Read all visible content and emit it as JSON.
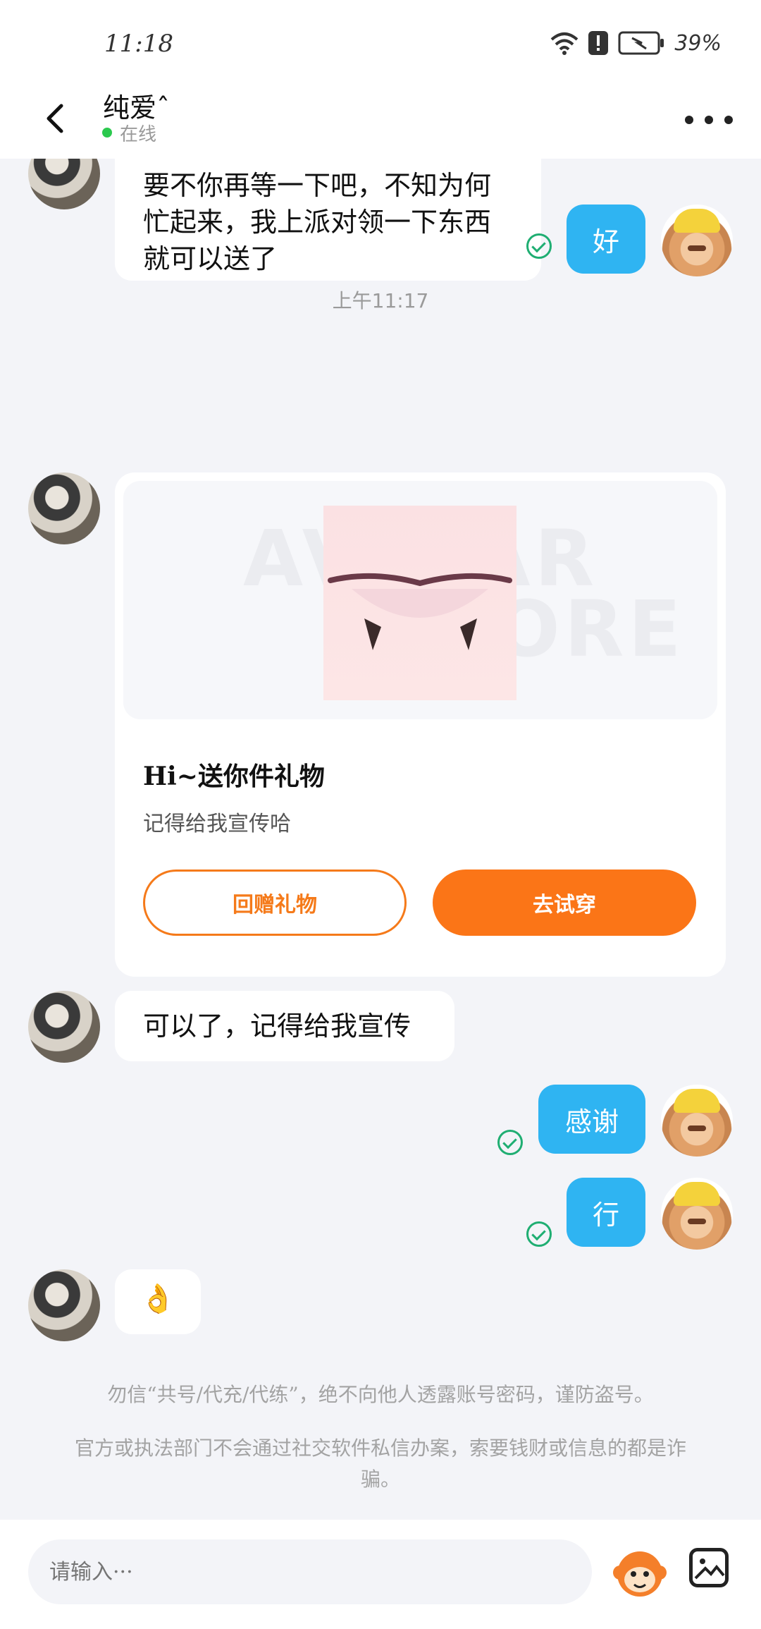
{
  "status": {
    "time": "11:18",
    "battery": "39%"
  },
  "header": {
    "name": "纯爱ˆ",
    "status": "在线"
  },
  "messages": {
    "m1": [
      "要不你再等一下吧，不知为何",
      "忙起来，我上派对领一下东西",
      "就可以送了"
    ],
    "m2": "好",
    "time_sep": "上午11:17",
    "gift": {
      "watermark_line1": "AVATAR",
      "watermark_line2": "STORE",
      "title": "Hi~送你件礼物",
      "subtitle": "记得给我宣传哈",
      "btn_return": "回赠礼物",
      "btn_try": "去试穿"
    },
    "m3": "可以了，记得给我宣传",
    "m4": "感谢",
    "m5": "行",
    "m6": "👌"
  },
  "notices": {
    "n1": "勿信“共号/代充/代练”，绝不向他人透露账号密码，谨防盗号。",
    "n2": "官方或执法部门不会通过社交软件私信办案，索要钱财或信息的都是诈骗。"
  },
  "input": {
    "placeholder": "请输入···"
  },
  "colors": {
    "accent": "#fb7517",
    "bubble_me": "#2fb4f2",
    "online": "#2bc94e",
    "read": "#1fae72"
  }
}
